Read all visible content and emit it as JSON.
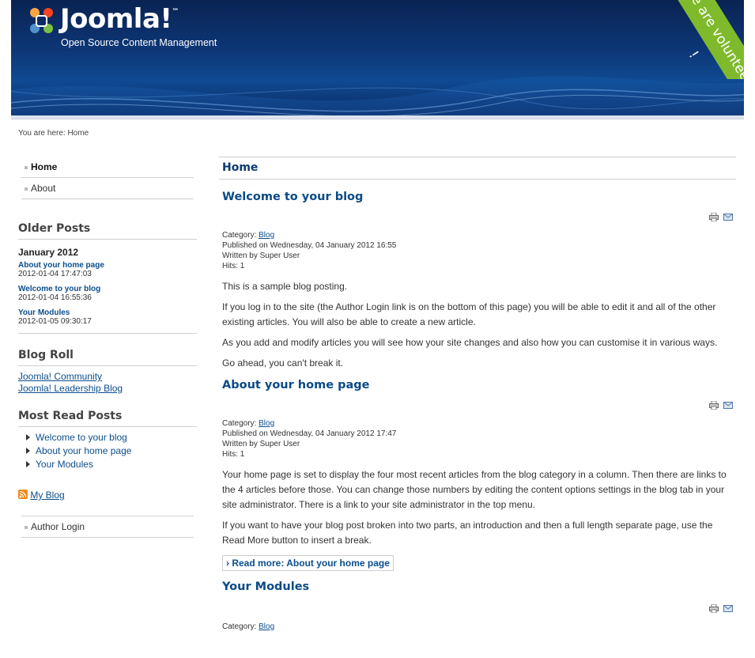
{
  "header": {
    "logo_text": "Joomla!",
    "logo_tm": "™",
    "tagline": "Open Source Content Management",
    "ribbon_text": "We are volunteers !"
  },
  "breadcrumb": "You are here: Home",
  "menu": {
    "items": [
      {
        "label": "Home",
        "active": true
      },
      {
        "label": "About",
        "active": false
      }
    ]
  },
  "older_posts": {
    "title": "Older Posts",
    "month": "January 2012",
    "posts": [
      {
        "title": "About your home page",
        "date": "2012-01-04 17:47:03"
      },
      {
        "title": "Welcome to your blog",
        "date": "2012-01-04 16:55:36"
      },
      {
        "title": "Your Modules",
        "date": "2012-01-05 09:30:17"
      }
    ]
  },
  "blog_roll": {
    "title": "Blog Roll",
    "links": [
      "Joomla! Community",
      "Joomla! Leadership Blog"
    ]
  },
  "most_read": {
    "title": "Most Read Posts",
    "items": [
      "Welcome to your blog",
      "About your home page",
      "Your Modules"
    ]
  },
  "feed_link": "My Blog",
  "author_login": "Author Login",
  "main": {
    "heading": "Home",
    "articles": [
      {
        "title": "Welcome to your blog",
        "category_label": "Category:",
        "category": "Blog",
        "published": "Published on Wednesday, 04 January 2012 16:55",
        "author": "Written by Super User",
        "hits": "Hits: 1",
        "paragraphs": [
          "This is a sample blog posting.",
          "If you log in to the site (the Author Login link is on the bottom of this page) you will be able to edit it and all of the other existing articles. You will also be able to create a new article.",
          "As you add and modify articles you will see how your site changes and also how you can customise it in various ways.",
          "Go ahead, you can't break it."
        ]
      },
      {
        "title": "About your home page",
        "category_label": "Category:",
        "category": "Blog",
        "published": "Published on Wednesday, 04 January 2012 17:47",
        "author": "Written by Super User",
        "hits": "Hits: 1",
        "paragraphs": [
          "Your home page is set to display the four most recent articles from the blog category in a column. Then there are links to the 4 articles before those.  You can change those numbers by editing the content options settings in the blog tab in your site administrator.  There is a link to your site administrator in the top menu.",
          "If you want to have your blog post broken into two parts, an introduction and then a full length separate page, use the Read More button to insert a break."
        ],
        "readmore": "› Read more: About your home page"
      },
      {
        "title": "Your Modules",
        "category_label": "Category:",
        "category": "Blog"
      }
    ]
  }
}
